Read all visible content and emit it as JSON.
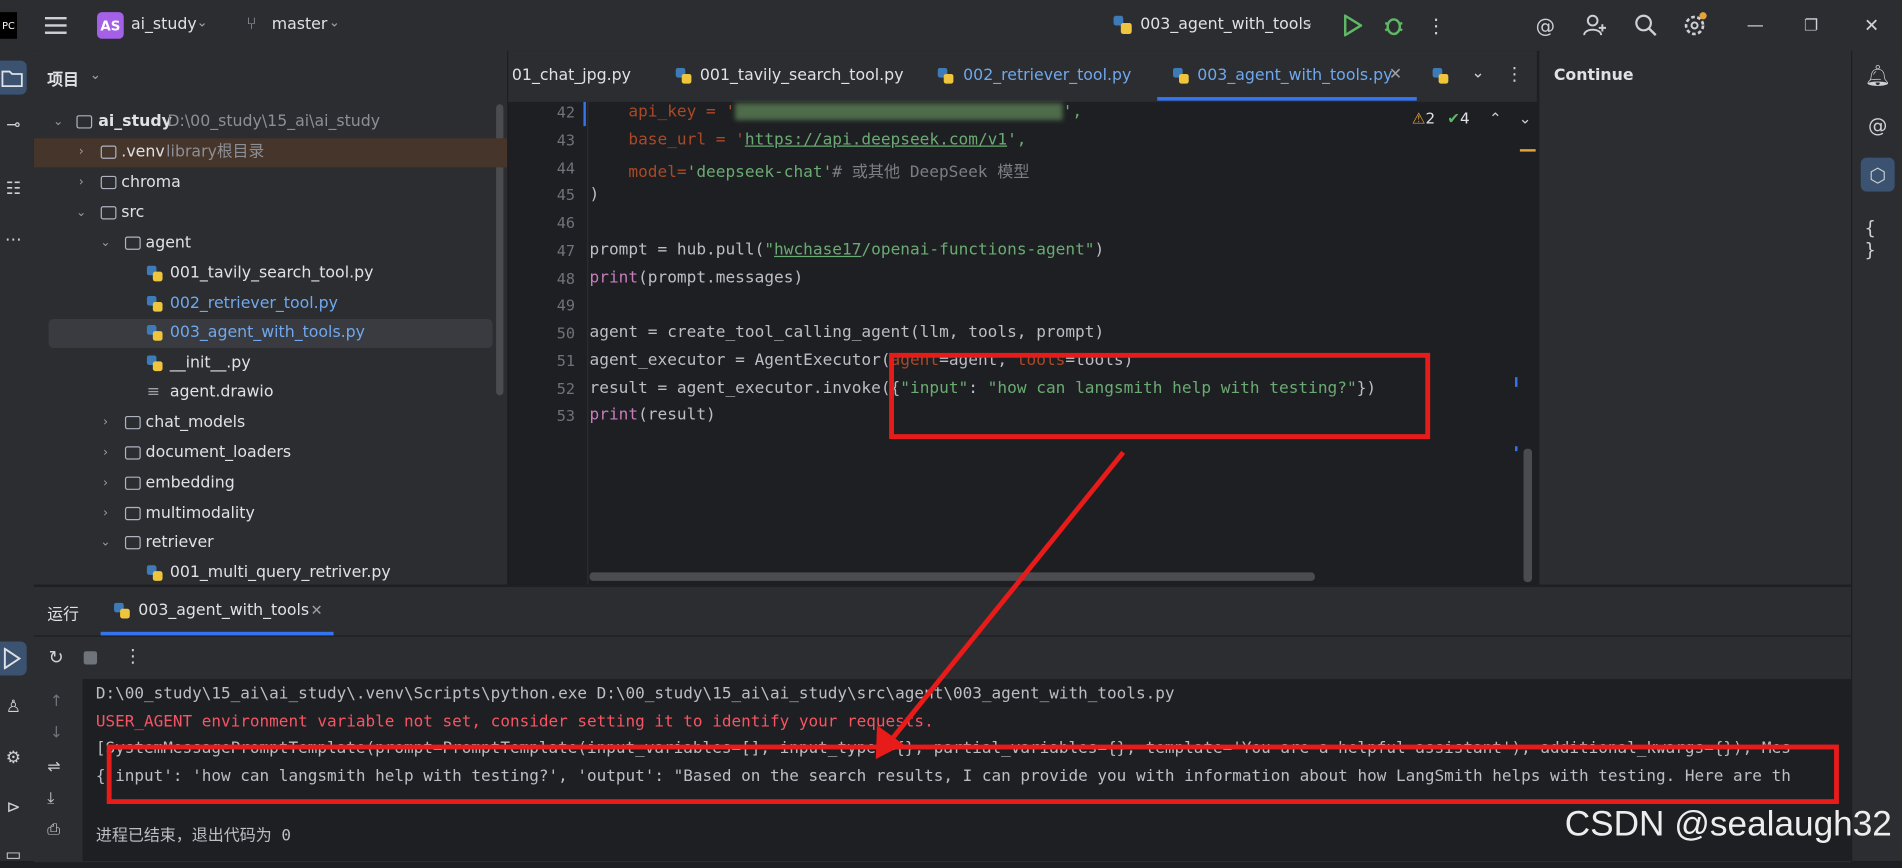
{
  "titlebar": {
    "project_badge": "AS",
    "project_name": "ai_study",
    "branch": "master",
    "run_config": "003_agent_with_tools"
  },
  "project_panel": {
    "title": "项目",
    "root_name": "ai_study",
    "root_path": "D:\\00_study\\15_ai\\ai_study",
    "venv_name": ".venv",
    "venv_hint": "library根目录",
    "items": [
      {
        "label": "chroma"
      },
      {
        "label": "src"
      },
      {
        "label": "agent"
      },
      {
        "label": "001_tavily_search_tool.py"
      },
      {
        "label": "002_retriever_tool.py"
      },
      {
        "label": "003_agent_with_tools.py"
      },
      {
        "label": "__init__.py"
      },
      {
        "label": "agent.drawio"
      },
      {
        "label": "chat_models"
      },
      {
        "label": "document_loaders"
      },
      {
        "label": "embedding"
      },
      {
        "label": "multimodality"
      },
      {
        "label": "retriever"
      },
      {
        "label": "001_multi_query_retriver.py"
      }
    ]
  },
  "editor": {
    "tabs": [
      {
        "label": "01_chat_jpg.py"
      },
      {
        "label": "001_tavily_search_tool.py"
      },
      {
        "label": "002_retriever_tool.py"
      },
      {
        "label": "003_agent_with_tools.py"
      }
    ],
    "warnings": "2",
    "checks": "4",
    "line_numbers": [
      "42",
      "43",
      "44",
      "45",
      "46",
      "47",
      "48",
      "49",
      "50",
      "51",
      "52",
      "53"
    ],
    "code": {
      "l42a": "    api_key = '",
      "l42b": "',",
      "l43a": "    base_url = '",
      "l43b": "https://api.deepseek.com/v1",
      "l43c": "',",
      "l44a": "    model=",
      "l44b": "'deepseek-chat'",
      "l44c": "# 或其他 DeepSeek 模型",
      "l45": ")",
      "l47a": "prompt = hub.pull(",
      "l47b": "\"",
      "l47c": "hwchase17",
      "l47d": "/openai-functions-agent\"",
      "l47e": ")",
      "l48a": "print",
      "l48b": "(prompt.messages)",
      "l50": "agent = create_tool_calling_agent(llm, tools, prompt)",
      "l51a": "agent_executor = AgentExecutor(",
      "l51b": "agent",
      "l51c": "=agent, ",
      "l51d": "tools",
      "l51e": "=tools)",
      "l52a": "result = agent_executor.invoke({",
      "l52b": "\"input\"",
      "l52c": ": ",
      "l52d": "\"how can langsmith help with testing?\"",
      "l52e": "})",
      "l53a": "print",
      "l53b": "(result)"
    }
  },
  "right_panel": {
    "title": "Continue"
  },
  "run_panel": {
    "tab_title": "运行",
    "tab_name": "003_agent_with_tools",
    "lines": {
      "cmd": "D:\\00_study\\15_ai\\ai_study\\.venv\\Scripts\\python.exe D:\\00_study\\15_ai\\ai_study\\src\\agent\\003_agent_with_tools.py",
      "warn": "USER_AGENT environment variable not set, consider setting it to identify your requests.",
      "prompt": "[SystemMessagePromptTemplate(prompt=PromptTemplate(input_variables=[], input_types={}, partial_variables={}, template='You are a helpful assistant'), additional_kwargs={}), Mes",
      "result": "{'input': 'how can langsmith help with testing?', 'output': \"Based on the search results, I can provide you with information about how LangSmith helps with testing. Here are th",
      "exit": "进程已结束，退出代码为 0"
    }
  },
  "watermark": "CSDN @sealaugh32"
}
